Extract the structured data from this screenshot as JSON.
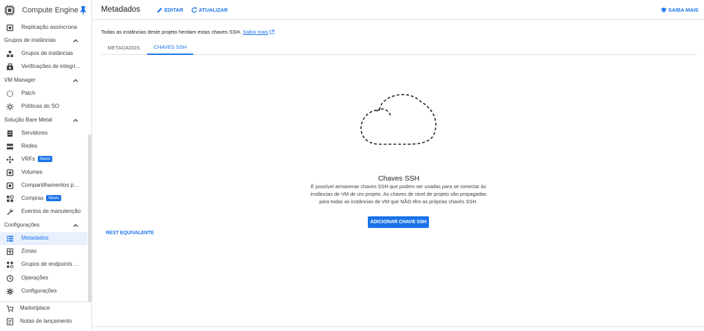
{
  "sidebar": {
    "product_title": "Compute Engine",
    "items": [
      {
        "label": "Replicação assíncrona",
        "icon": "disk-icon"
      },
      {
        "section": "Grupos de instâncias"
      },
      {
        "label": "Grupos de instâncias",
        "icon": "instance-groups-icon"
      },
      {
        "label": "Verificações de integridade",
        "icon": "health-check-icon"
      },
      {
        "section": "VM Manager"
      },
      {
        "label": "Patch",
        "icon": "patch-icon"
      },
      {
        "label": "Políticas do SO",
        "icon": "os-policy-icon"
      },
      {
        "section": "Solução Bare Metal"
      },
      {
        "label": "Servidores",
        "icon": "server-icon"
      },
      {
        "label": "Redes",
        "icon": "network-icon"
      },
      {
        "label": "VRFs",
        "icon": "vrf-icon",
        "badge": "Novo"
      },
      {
        "label": "Volumes",
        "icon": "volume-icon"
      },
      {
        "label": "Compartilhamentos por NFS",
        "icon": "nfs-share-icon"
      },
      {
        "label": "Compras",
        "icon": "purchases-icon",
        "badge": "Novo"
      },
      {
        "label": "Eventos de manutenção",
        "icon": "wrench-icon"
      },
      {
        "section": "Configurações"
      },
      {
        "label": "Metadados",
        "icon": "metadata-icon",
        "active": true
      },
      {
        "label": "Zonas",
        "icon": "zones-icon"
      },
      {
        "label": "Grupos de endpoints da rede",
        "icon": "endpoint-groups-icon"
      },
      {
        "label": "Operações",
        "icon": "operations-icon"
      },
      {
        "label": "Configurações",
        "icon": "settings-icon"
      }
    ],
    "bottom": [
      {
        "label": "Marketplace",
        "icon": "cart-icon"
      },
      {
        "label": "Notas de lançamento",
        "icon": "notes-icon"
      }
    ]
  },
  "header": {
    "title": "Metadados",
    "edit_label": "EDITAR",
    "refresh_label": "ATUALIZAR",
    "learn_label": "SAIBA MAIS"
  },
  "info": {
    "text": "Todas as instâncias deste projeto herdam estas chaves SSH.",
    "link": "Saiba mais"
  },
  "tabs": [
    "METADADOS",
    "CHAVES SSH"
  ],
  "active_tab": "CHAVES SSH",
  "empty_state": {
    "title": "Chaves SSH",
    "description": "É possível armazenar chaves SSH que podem ser usadas para se conectar às instâncias de VM de um projeto. As chaves de nível de projeto são propagadas para todas as instâncias de VM que NÃO têm as próprias chaves SSH.",
    "button": "ADICIONAR CHAVE SSH"
  },
  "rest_link": "REST EQUIVALENTE",
  "colors": {
    "accent": "#1a73e8",
    "active_bg": "#e8f0fe"
  }
}
